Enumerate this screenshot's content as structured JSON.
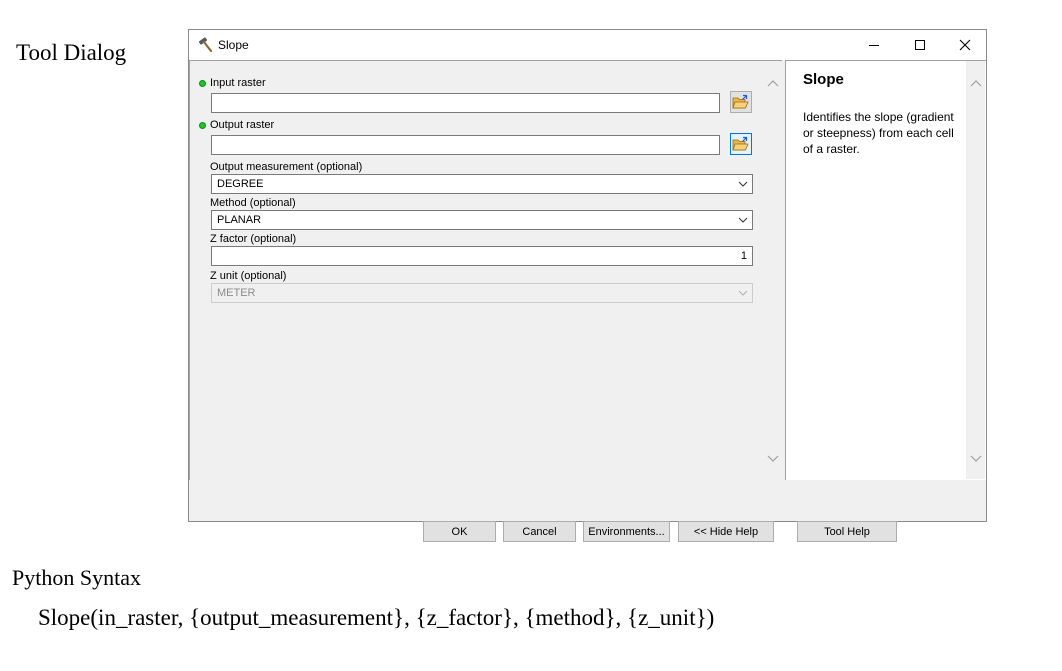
{
  "doc": {
    "tool_dialog_heading": "Tool Dialog",
    "python_syntax_heading": "Python Syntax",
    "python_code": "Slope(in_raster, {output_measurement}, {z_factor}, {method}, {z_unit})"
  },
  "window": {
    "title": "Slope",
    "icon": "hammer-icon"
  },
  "form": {
    "input_raster": {
      "label": "Input raster",
      "value": ""
    },
    "output_raster": {
      "label": "Output raster",
      "value": ""
    },
    "output_measurement": {
      "label": "Output measurement (optional)",
      "value": "DEGREE"
    },
    "method": {
      "label": "Method (optional)",
      "value": "PLANAR"
    },
    "z_factor": {
      "label": "Z factor (optional)",
      "value": "1"
    },
    "z_unit": {
      "label": "Z unit (optional)",
      "value": "METER"
    }
  },
  "help": {
    "title": "Slope",
    "body": "Identifies the slope (gradient or steepness) from each cell of a raster."
  },
  "buttons": {
    "ok": "OK",
    "cancel": "Cancel",
    "environments": "Environments...",
    "hide_help": "<< Hide Help",
    "tool_help": "Tool Help"
  },
  "colors": {
    "required_indicator": "#22c22e",
    "focus_border": "#0078d7",
    "panel_background": "#f0f0f0"
  }
}
